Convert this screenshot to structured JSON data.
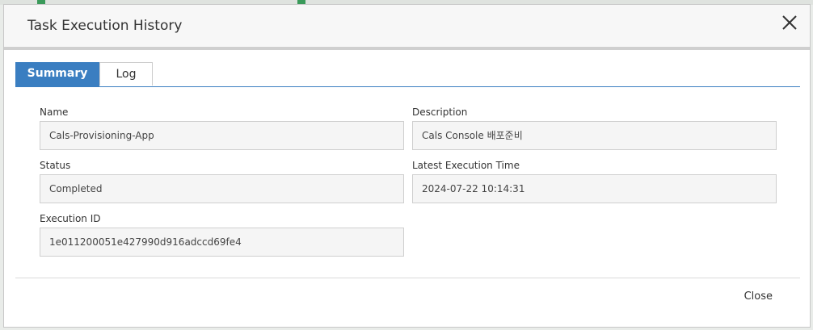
{
  "dialog": {
    "title": "Task Execution History"
  },
  "tabs": [
    {
      "label": "Summary",
      "active": true
    },
    {
      "label": "Log",
      "active": false
    }
  ],
  "fields": {
    "name": {
      "label": "Name",
      "value": "Cals-Provisioning-App"
    },
    "description": {
      "label": "Description",
      "value": "Cals Console 배포준비"
    },
    "status": {
      "label": "Status",
      "value": "Completed"
    },
    "latest_execution_time": {
      "label": "Latest Execution Time",
      "value": "2024-07-22 10:14:31"
    },
    "execution_id": {
      "label": "Execution ID",
      "value": "1e011200051e427990d916adccd69fe4"
    }
  },
  "footer": {
    "close_label": "Close"
  },
  "colors": {
    "accent": "#3a7ec1",
    "field_bg": "#f5f5f5",
    "header_bg": "#f7f7f7"
  }
}
